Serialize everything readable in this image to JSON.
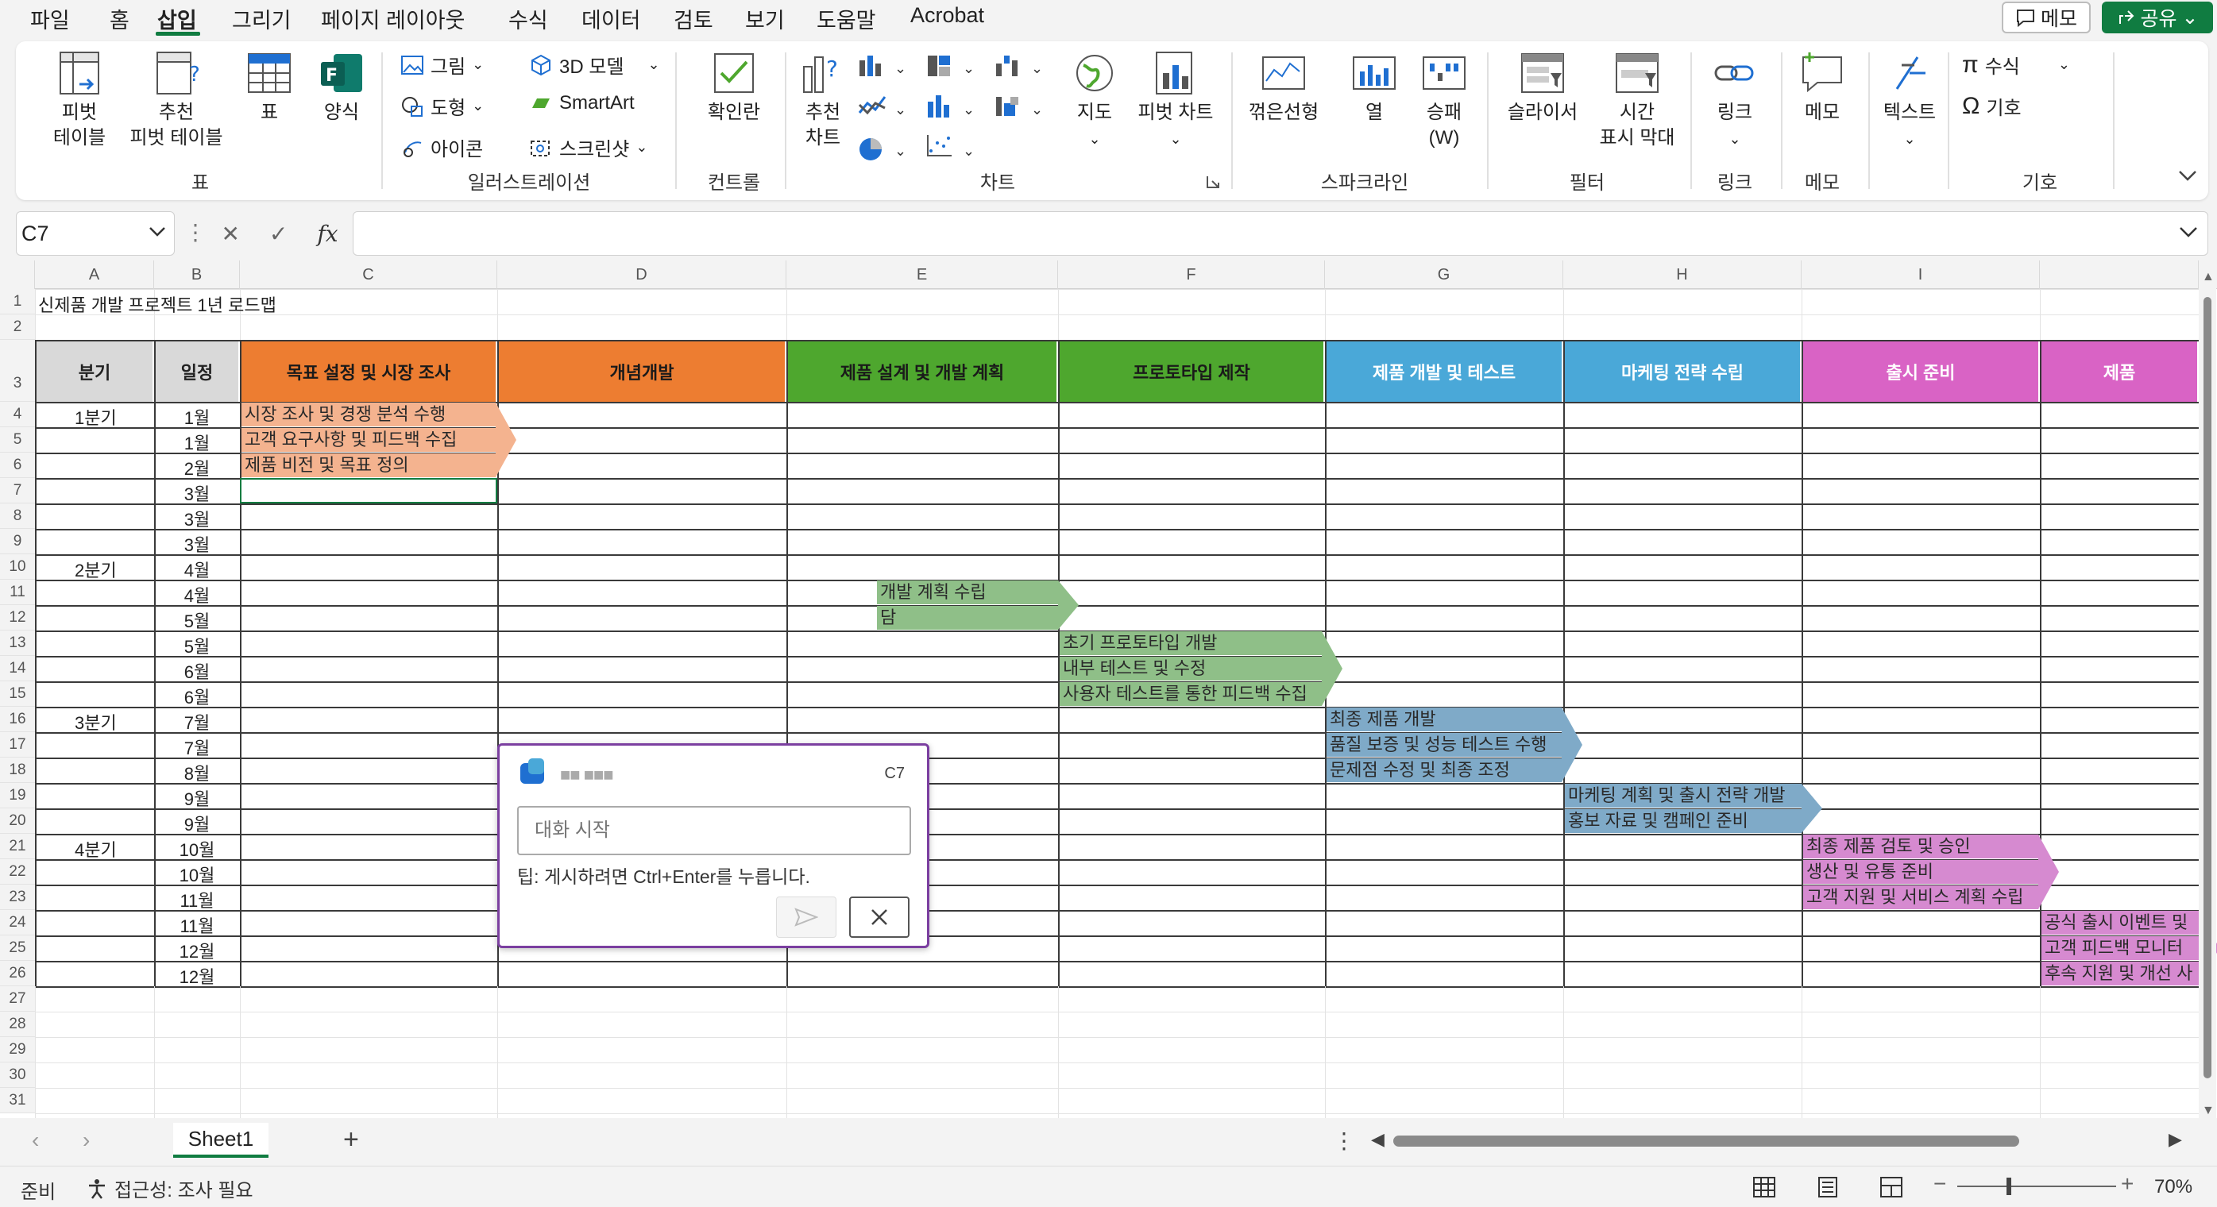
{
  "menu": {
    "items": [
      "파일",
      "홈",
      "삽입",
      "그리기",
      "페이지 레이아웃",
      "수식",
      "데이터",
      "검토",
      "보기",
      "도움말",
      "Acrobat"
    ],
    "memo_button": "메모",
    "share_button": "공유"
  },
  "ribbon": {
    "pivot_table": "피벗\n테이블",
    "pivot_arrow": "⌄",
    "recommended_pivot": "추천\n피벗 테이블",
    "table": "표",
    "forms": "양식",
    "group_table": "표",
    "picture": "그림",
    "shapes": "도형",
    "icons": "아이콘",
    "model3d": "3D 모델",
    "smartart": "SmartArt",
    "screenshot": "스크린샷",
    "group_illustrations": "일러스트레이션",
    "checkbox": "확인란",
    "group_controls": "컨트롤",
    "recommended_charts": "추천\n차트",
    "maps": "지도",
    "pivot_chart": "피벗 차트",
    "group_charts": "차트",
    "spark_line": "꺾은선형",
    "spark_column": "열",
    "spark_winloss": "승패\n(W)",
    "group_sparklines": "스파크라인",
    "slicer": "슬라이서",
    "timeline": "시간\n표시 막대",
    "group_filters": "필터",
    "link": "링크",
    "group_links": "링크",
    "comment": "메모",
    "group_comments": "메모",
    "text": "텍스트",
    "equation": "수식",
    "symbol": "기호",
    "group_symbols": "기호"
  },
  "formula_bar": {
    "name_box": "C7",
    "fx": "fx",
    "value": ""
  },
  "columns": [
    "A",
    "B",
    "C",
    "D",
    "E",
    "F",
    "G",
    "H",
    "I"
  ],
  "rows": [
    "1",
    "2",
    "3",
    "4",
    "5",
    "6",
    "7",
    "8",
    "9",
    "10",
    "11",
    "12",
    "13",
    "14",
    "15",
    "16",
    "17",
    "18",
    "19",
    "20",
    "21",
    "22",
    "23",
    "24",
    "25",
    "26",
    "27",
    "28",
    "29",
    "30",
    "31"
  ],
  "sheet": {
    "title": "신제품 개발 프로젝트 1년 로드맵",
    "header_quarter": "분기",
    "header_schedule": "일정",
    "phases": [
      {
        "label": "목표 설정 및 시장 조사",
        "color": "#ed7d31"
      },
      {
        "label": "개념개발",
        "color": "#ed7d31"
      },
      {
        "label": "제품 설계 및 개발 계획",
        "color": "#4ea72e"
      },
      {
        "label": "프로토타입 제작",
        "color": "#4ea72e"
      },
      {
        "label": "제품 개발 및 테스트",
        "color": "#4aa8d8"
      },
      {
        "label": "마케팅 전략 수립",
        "color": "#4aa8d8"
      },
      {
        "label": "출시 준비",
        "color": "#d963c5"
      },
      {
        "label": "제품",
        "color": "#d963c5"
      }
    ],
    "quarters": [
      "1분기",
      "2분기",
      "3분기",
      "4분기"
    ],
    "months": [
      "1월",
      "1월",
      "2월",
      "3월",
      "3월",
      "3월",
      "4월",
      "4월",
      "5월",
      "5월",
      "6월",
      "6월",
      "7월",
      "7월",
      "8월",
      "9월",
      "9월",
      "10월",
      "10월",
      "11월",
      "11월",
      "12월",
      "12월"
    ],
    "tasks": {
      "q1": [
        "시장 조사 및 경쟁 분석 수행",
        "고객 요구사항 및 피드백 수집",
        "제품 비전 및 목표 정의"
      ],
      "q2a": [
        "개발 계획 수립",
        "담"
      ],
      "q2b": [
        "초기 프로토타입 개발",
        "내부 테스트 및 수정",
        "사용자 테스트를 통한 피드백 수집"
      ],
      "q3a": [
        "최종 제품 개발",
        "품질 보증 및 성능 테스트 수행",
        "문제점 수정 및 최종 조정"
      ],
      "q3b": [
        "마케팅 계획 및 출시 전략 개발",
        "홍보 자료 및 캠페인 준비"
      ],
      "q4a": [
        "최종 제품 검토 및 승인",
        "생산 및 유통 준비",
        "고객 지원 및 서비스 계획 수립"
      ],
      "q4b": [
        "공식 출시 이벤트 및",
        "고객 피드백 모니터",
        "후속 지원 및 개선 사"
      ]
    }
  },
  "comment": {
    "author": "■■ ■■■",
    "cell_ref": "C7",
    "placeholder": "대화 시작",
    "tip": "팁: 게시하려면 Ctrl+Enter를 누릅니다."
  },
  "tabs": {
    "sheet1": "Sheet1",
    "add": "+"
  },
  "status": {
    "ready": "준비",
    "accessibility": "접근성: 조사 필요",
    "zoom": "70%"
  }
}
